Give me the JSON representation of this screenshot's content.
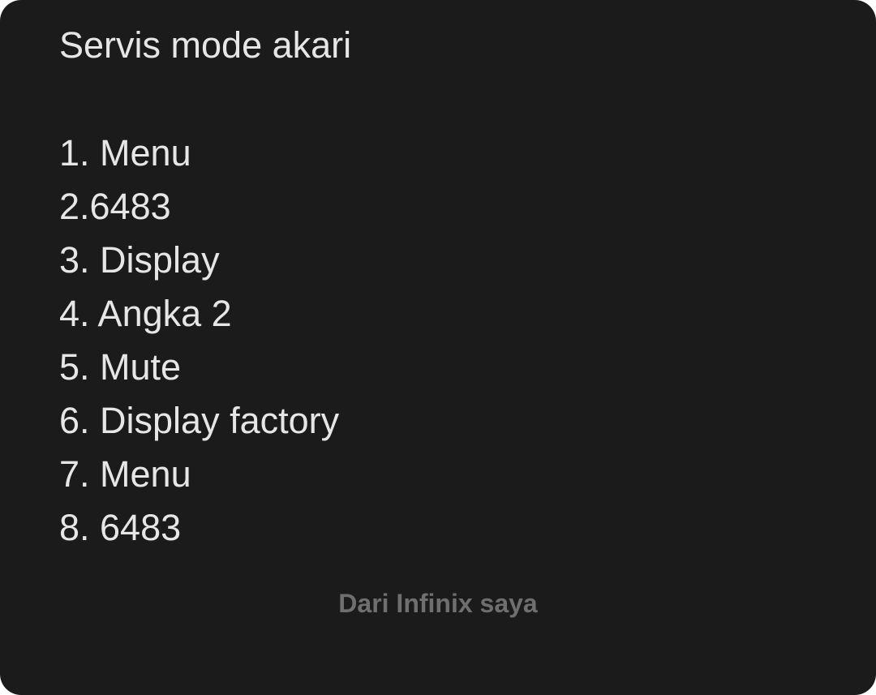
{
  "note": {
    "title": "Servis mode akari",
    "items": [
      "1. Menu",
      "2.6483",
      "3. Display",
      "4. Angka 2",
      "5. Mute",
      "6. Display factory",
      "7. Menu",
      "8. 6483"
    ],
    "signature": "Dari Infinix saya"
  },
  "colors": {
    "background": "#1b1b1b",
    "text": "#e6e6e6",
    "signature": "#6f6f6f"
  }
}
